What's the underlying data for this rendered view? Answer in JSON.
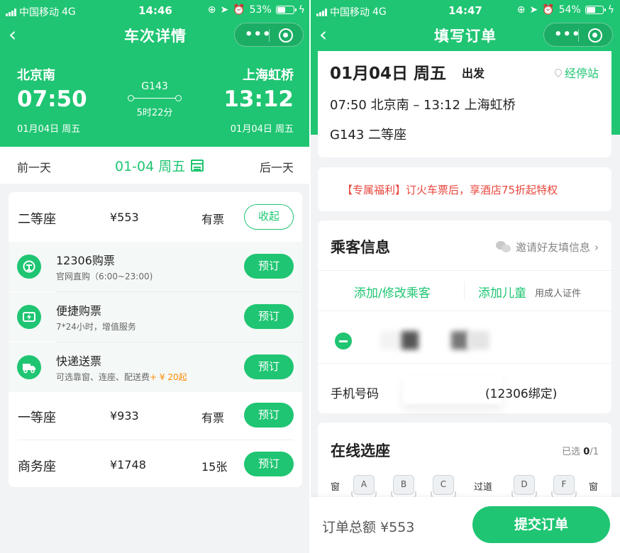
{
  "left": {
    "status": {
      "carrier": "中国移动",
      "network": "4G",
      "time": "14:46",
      "battery": "53%",
      "battery_level": 0.53
    },
    "nav": {
      "title": "车次详情",
      "more": "•••"
    },
    "trip": {
      "from_station": "北京南",
      "to_station": "上海虹桥",
      "dep_time": "07:50",
      "arr_time": "13:12",
      "dep_date": "01月04日 周五",
      "arr_date": "01月04日 周五",
      "train_no": "G143",
      "duration": "5时22分"
    },
    "datebar": {
      "prev": "前一天",
      "current": "01-04 周五",
      "next": "后一天"
    },
    "seats": [
      {
        "name": "二等座",
        "price": "¥553",
        "avail": "有票",
        "action": "收起"
      },
      {
        "name": "一等座",
        "price": "¥933",
        "avail": "有票",
        "action": "预订"
      },
      {
        "name": "商务座",
        "price": "¥1748",
        "avail": "15张",
        "action": "预订"
      }
    ],
    "channels": [
      {
        "icon": "railway-logo-icon",
        "title": "12306购票",
        "desc": "官网直购（6:00~23:00)",
        "action": "预订"
      },
      {
        "icon": "lightning-ticket-icon",
        "title": "便捷购票",
        "desc": "7*24小时，增值服务",
        "action": "预订"
      },
      {
        "icon": "delivery-truck-icon",
        "title": "快递送票",
        "desc": "可选靠窗、连座、配送费",
        "desc_extra": "+ ¥ 20起",
        "action": "预订"
      }
    ]
  },
  "right": {
    "status": {
      "carrier": "中国移动",
      "network": "4G",
      "time": "14:47",
      "battery": "54%",
      "battery_level": 0.54
    },
    "nav": {
      "title": "填写订单",
      "more": "•••"
    },
    "trip": {
      "date": "01月04日 周五",
      "dep_label": "出发",
      "stops_link": "经停站",
      "route": "07:50 北京南 – 13:12 上海虹桥",
      "seat": "G143 二等座"
    },
    "promo": "【专属福利】订火车票后，享酒店75折起特权",
    "passenger": {
      "title": "乘客信息",
      "invite": "邀请好友填信息",
      "add_passenger": "添加/修改乘客",
      "add_child": "添加儿童",
      "add_child_note": "用成人证件",
      "phone_label": "手机号码",
      "phone_tag": "(12306绑定)"
    },
    "seat_select": {
      "title": "在线选座",
      "selected_prefix": "已选 ",
      "selected_count": "0",
      "selected_total": "/1",
      "window": "窗",
      "aisle": "过道",
      "seats": [
        "A",
        "B",
        "C",
        "D",
        "F"
      ]
    },
    "footer": {
      "total": "订单总额 ¥553",
      "submit": "提交订单"
    }
  },
  "colors": {
    "brand": "#1fc572",
    "promo": "#e8473d",
    "extra_fee": "#ff8a00"
  }
}
